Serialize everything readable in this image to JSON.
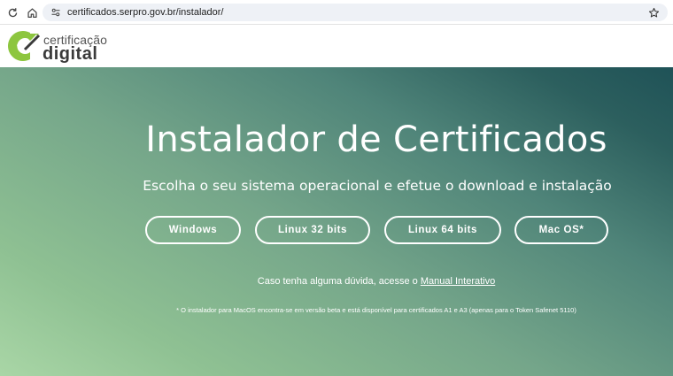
{
  "browser": {
    "url": "certificados.serpro.gov.br/instalador/",
    "icons": [
      "reload-icon",
      "home-icon",
      "site-info-icon",
      "bookmark-star-icon"
    ]
  },
  "header": {
    "logo_top": "certificação",
    "logo_bottom": "digital",
    "colors": {
      "logo_green": "#8dc63f",
      "logo_dark": "#3a3a3a"
    }
  },
  "hero": {
    "title": "Instalador de Certificados",
    "subtitle": "Escolha o seu sistema operacional e efetue o download e instalação",
    "buttons": [
      {
        "label": "Windows"
      },
      {
        "label": "Linux 32 bits"
      },
      {
        "label": "Linux 64 bits"
      },
      {
        "label": "Mac OS*"
      }
    ],
    "help_text": "Caso tenha alguma dúvida, acesse o",
    "help_link": "Manual Interativo",
    "footnote": "* O instalador para MacOS encontra-se em versão beta e está disponível para certificados A1 e A3 (apenas para o Token Safenet 5110)",
    "colors": {
      "gradient_light": "#a9d6a6",
      "gradient_dark": "#1f5257"
    }
  }
}
